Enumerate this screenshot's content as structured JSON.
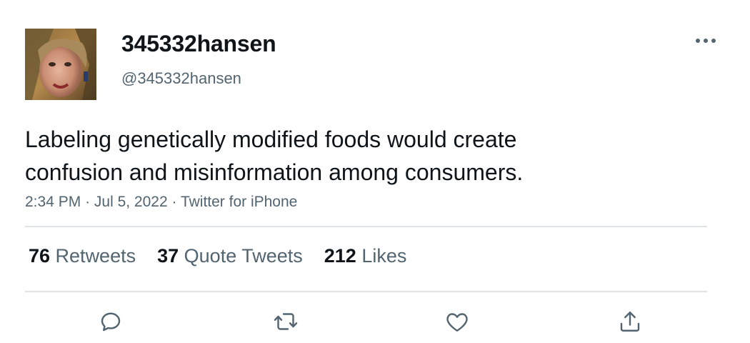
{
  "user": {
    "display_name": "345332hansen",
    "handle": "@345332hansen",
    "avatar_icon": "profile-photo"
  },
  "tweet": {
    "text_line1": "Labeling genetically modified foods would create",
    "text_line2": "confusion and misinformation among consumers.",
    "time": "2:34 PM",
    "separator": "·",
    "date": "Jul 5, 2022",
    "source": "Twitter for iPhone"
  },
  "stats": {
    "retweets_count": "76",
    "retweets_label": "Retweets",
    "quotes_count": "37",
    "quotes_label": "Quote Tweets",
    "likes_count": "212",
    "likes_label": "Likes"
  },
  "actions": {
    "reply_icon": "reply-icon",
    "retweet_icon": "retweet-icon",
    "like_icon": "heart-icon",
    "share_icon": "share-icon",
    "more_icon": "more-dots-icon"
  },
  "colors": {
    "text_primary": "#0f1419",
    "text_secondary": "#536471",
    "divider": "#dde3e7",
    "icon": "#536471"
  }
}
